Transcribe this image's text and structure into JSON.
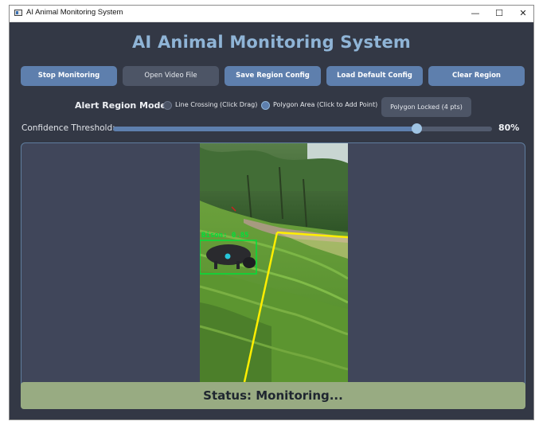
{
  "window": {
    "title": "AI Animal Monitoring System",
    "controls": {
      "minimize": "—",
      "maximize": "☐",
      "close": "✕"
    }
  },
  "header": {
    "title": "AI Animal Monitoring System"
  },
  "toolbar": {
    "stop_monitoring": "Stop Monitoring",
    "open_video_file": "Open Video File",
    "save_region_config": "Save Region Config",
    "load_default_config": "Load Default Config",
    "clear_region": "Clear Region"
  },
  "alert_region": {
    "label": "Alert Region Mode:",
    "options": [
      {
        "label": "Line Crossing (Click  Drag)",
        "selected": false
      },
      {
        "label": "Polygon Area (Click to Add Point)",
        "selected": true
      }
    ],
    "lock_button": "Polygon Locked (4 pts)"
  },
  "confidence": {
    "label": "Confidence Threshold:",
    "value_text": "80%",
    "value": 0.8
  },
  "video": {
    "detection_label": "Bison: 0.85",
    "detection_color": "#00e03a",
    "region_color": "#ffee00"
  },
  "status": {
    "text": "Status: Monitoring..."
  },
  "colors": {
    "accent": "#5e7fad",
    "title": "#8fb4d6",
    "background": "#333845",
    "status_bar": "#98ab82"
  }
}
